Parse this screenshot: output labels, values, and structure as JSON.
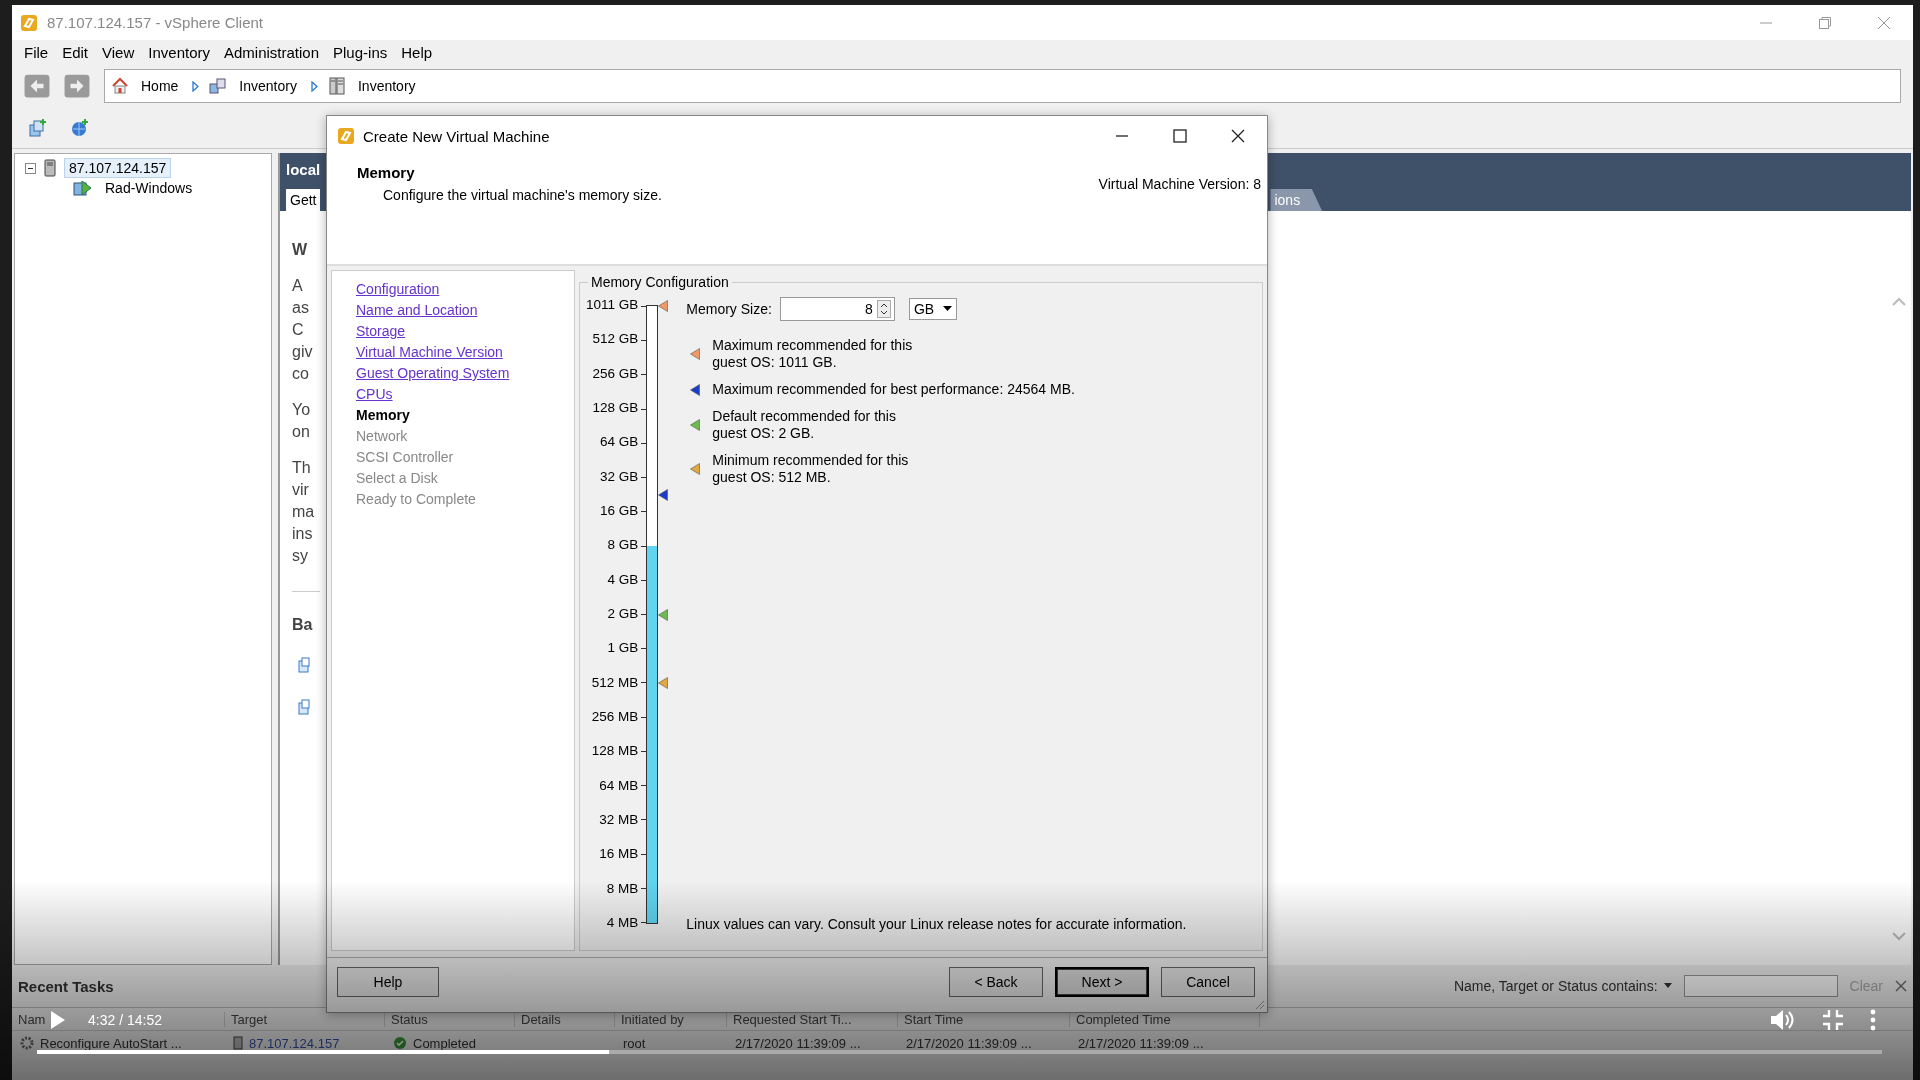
{
  "window": {
    "title": "87.107.124.157 - vSphere Client"
  },
  "menu": [
    "File",
    "Edit",
    "View",
    "Inventory",
    "Administration",
    "Plug-ins",
    "Help"
  ],
  "breadcrumbs": [
    {
      "label": "Home"
    },
    {
      "label": "Inventory"
    },
    {
      "label": "Inventory"
    }
  ],
  "tree": [
    {
      "label": "87.107.124.157",
      "expanded": true,
      "selected": true,
      "children": [
        {
          "label": "Rad-Windows",
          "selected": false
        }
      ]
    }
  ],
  "content": {
    "header": "local",
    "tabs": [
      {
        "label": "Gett",
        "selected": true
      },
      {
        "label": "ions",
        "selected": false
      }
    ],
    "heading": "W",
    "paragraphs": [
      [
        "A",
        "as",
        "C",
        "giv",
        "co"
      ],
      [
        "Yo",
        "on"
      ],
      [
        "Th",
        "vir",
        "ma",
        "ins",
        "sy"
      ]
    ],
    "section_heading": "Ba"
  },
  "dialog": {
    "title": "Create New Virtual Machine",
    "heading": "Memory",
    "subtitle": "Configure the virtual machine's memory size.",
    "version": "Virtual Machine Version: 8",
    "steps": [
      {
        "label": "Configuration",
        "selected": false,
        "disabled": false
      },
      {
        "label": "Name and Location",
        "selected": false,
        "disabled": false
      },
      {
        "label": "Storage",
        "selected": false,
        "disabled": false
      },
      {
        "label": "Virtual Machine Version",
        "selected": false,
        "disabled": false
      },
      {
        "label": "Guest Operating System",
        "selected": false,
        "disabled": false
      },
      {
        "label": "CPUs",
        "selected": false,
        "disabled": false
      },
      {
        "label": "Memory",
        "selected": true,
        "disabled": false
      },
      {
        "label": "Network",
        "selected": false,
        "disabled": true
      },
      {
        "label": "SCSI Controller",
        "selected": false,
        "disabled": true
      },
      {
        "label": "Select a Disk",
        "selected": false,
        "disabled": true
      },
      {
        "label": "Ready to Complete",
        "selected": false,
        "disabled": true
      }
    ],
    "group_title": "Memory Configuration",
    "memory_size": {
      "label": "Memory Size:",
      "value": "8",
      "unit": "GB"
    },
    "slider": {
      "level": 0.611,
      "labels": [
        "1011 GB",
        "512 GB",
        "256 GB",
        "128 GB",
        "64 GB",
        "32 GB",
        "16 GB",
        "8 GB",
        "4 GB",
        "2 GB",
        "1 GB",
        "512 MB",
        "256 MB",
        "128 MB",
        "64 MB",
        "32 MB",
        "16 MB",
        "8 MB",
        "4 MB"
      ],
      "markers": [
        {
          "level": 1.0,
          "color": "#f09a6a"
        },
        {
          "level": 0.694,
          "color": "#1a3cc8"
        },
        {
          "level": 0.5,
          "color": "#6cba50"
        },
        {
          "level": 0.389,
          "color": "#e0a840"
        }
      ]
    },
    "legend": [
      {
        "text": "Maximum recommended for this\nguest OS: 1011 GB.",
        "color": "#f09a6a"
      },
      {
        "text": "Maximum recommended for best performance: 24564 MB.",
        "color": "#1a3cc8"
      },
      {
        "text": "Default recommended for this\nguest OS: 2 GB.",
        "color": "#6cba50"
      },
      {
        "text": "Minimum recommended for this\nguest OS: 512 MB.",
        "color": "#e0a840"
      }
    ],
    "note": "Linux values can vary. Consult your Linux release notes for accurate information.",
    "buttons": [
      {
        "label": "Help",
        "kind": "help",
        "default": false
      },
      {
        "label": "< Back",
        "kind": "nav",
        "default": false
      },
      {
        "label": "Next >",
        "kind": "nav",
        "default": true
      },
      {
        "label": "Cancel",
        "kind": "nav",
        "default": false
      }
    ]
  },
  "tasks": {
    "title": "Recent Tasks",
    "filter_label": "Name, Target or Status contains:",
    "clear": "Clear",
    "columns": [
      "Nam",
      "Target",
      "Status",
      "Details",
      "Initiated by",
      "Requested Start Ti...",
      "Start Time",
      "Completed Time"
    ],
    "rows": [
      {
        "name": "Reconfigure AutoStart ...",
        "target": "87.107.124.157",
        "status": "Completed",
        "initiated_by": "root",
        "requested": "2/17/2020 11:39:09 ...",
        "start": "2/17/2020 11:39:09 ...",
        "completed": "2/17/2020 11:39:09 ..."
      }
    ]
  },
  "video": {
    "playing": false,
    "time": "4:32 / 14:52",
    "level": 0.31
  }
}
